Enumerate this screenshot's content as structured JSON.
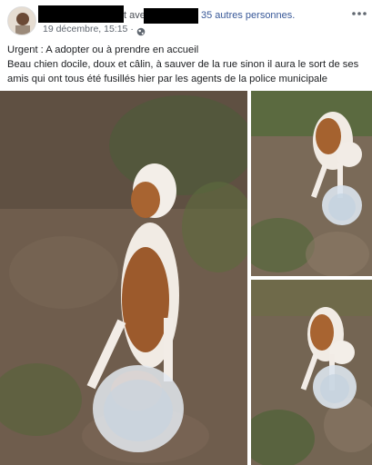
{
  "post": {
    "author_suffix": "t ave",
    "with_others": "35 autres personnes.",
    "timestamp": "19 décembre, 15:15 ·",
    "body_line1": "Urgent : A adopter ou à prendre en accueil",
    "body_line2": "Beau chien docile, doux et câlin, à sauver de la rue sinon il aura le sort de ses",
    "body_line3": "amis qui ont tous été fusillés hier par les agents de la police municipale"
  },
  "icons": {
    "privacy": "globe-icon",
    "menu": "more-icon"
  }
}
